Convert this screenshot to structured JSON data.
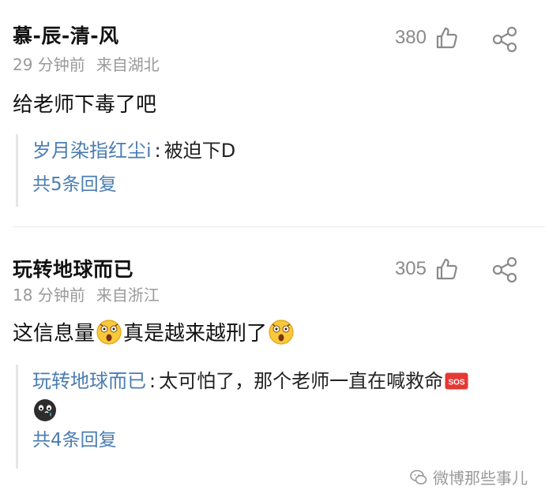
{
  "comments": [
    {
      "username": "慕-辰-清-风",
      "time": "29 分钟前",
      "location": "来自湖北",
      "likes": "380",
      "text": "给老师下毒了吧",
      "reply": {
        "author": "岁月染指红尘i",
        "colon": ":",
        "text": "被迫下D",
        "more": "共5条回复"
      }
    },
    {
      "username": "玩转地球而已",
      "time": "18 分钟前",
      "location": "来自浙江",
      "likes": "305",
      "text_part1": "这信息量",
      "text_part2": "真是越来越刑了",
      "reply": {
        "author": "玩转地球而已",
        "colon": ":",
        "text": "太可怕了，那个老师一直在喊救命",
        "more": "共4条回复"
      }
    }
  ],
  "icons": {
    "like": "thumbs-up-icon",
    "share": "share-icon",
    "emoji_shocked": "shocked-face-emoji",
    "emoji_sos": "sos-icon",
    "emoji_cry": "crying-face-icon"
  },
  "watermark": {
    "text": "微博那些事儿"
  },
  "colors": {
    "link": "#4a7db3",
    "meta": "#9a9a9a",
    "border": "#e6e6e6"
  }
}
